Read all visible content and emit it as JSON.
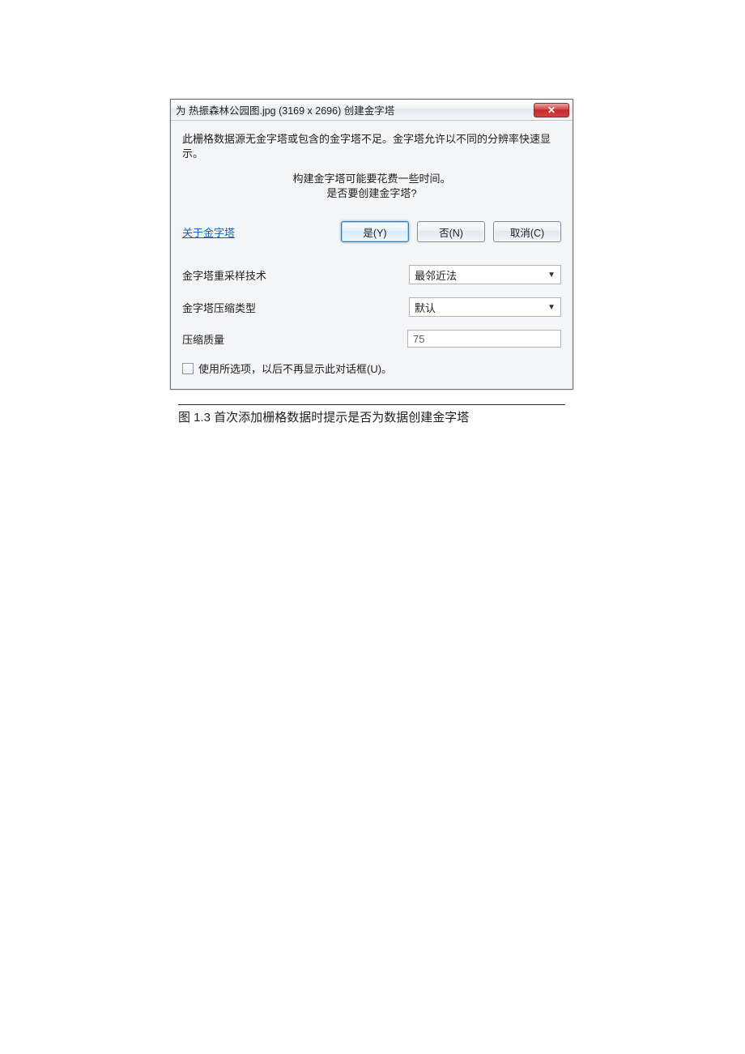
{
  "dialog": {
    "title": "为 热振森林公园图.jpg (3169 x 2696) 创建金字塔",
    "message1": "此栅格数据源无金字塔或包含的金字塔不足。金字塔允许以不同的分辨率快速显示。",
    "message2_line1": "构建金字塔可能要花费一些时间。",
    "message2_line2": "是否要创建金字塔?",
    "link_label": "关于金字塔",
    "buttons": {
      "yes": "是(Y)",
      "no": "否(N)",
      "cancel": "取消(C)"
    },
    "options": {
      "resample_label": "金字塔重采样技术",
      "resample_value": "最邻近法",
      "compression_label": "金字塔压缩类型",
      "compression_value": "默认",
      "quality_label": "压缩质量",
      "quality_value": "75"
    },
    "checkbox_label": "使用所选项，以后不再显示此对话框(U)。",
    "close_glyph": "✕"
  },
  "caption": "图 1.3 首次添加栅格数据时提示是否为数据创建金字塔"
}
